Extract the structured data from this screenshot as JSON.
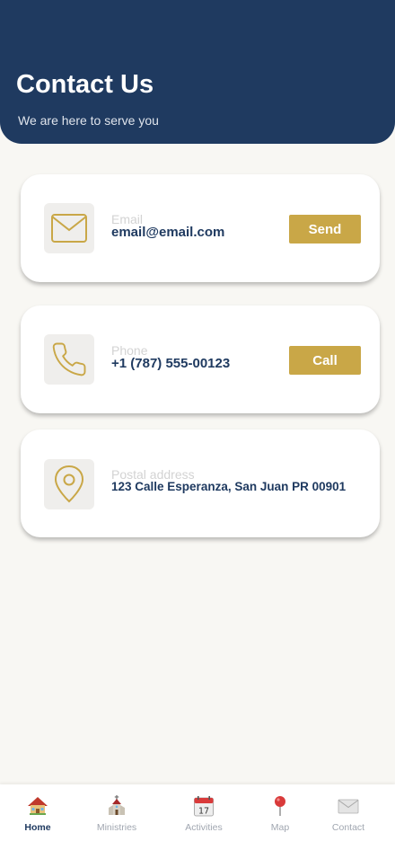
{
  "header": {
    "title": "Contact Us",
    "subtitle": "We are here to serve you"
  },
  "contacts": [
    {
      "icon": "mail-icon",
      "label": "Email",
      "value": "email@email.com",
      "action": "Send"
    },
    {
      "icon": "phone-icon",
      "label": "Phone",
      "value": "+1 (787) 555-00123",
      "action": "Call"
    },
    {
      "icon": "location-pin-icon",
      "label": "Postal address",
      "value": "123 Calle Esperanza, San Juan PR 00901"
    }
  ],
  "tabs": [
    {
      "icon": "house-icon",
      "label": "Home",
      "active": true
    },
    {
      "icon": "church-icon",
      "label": "Ministries",
      "active": false
    },
    {
      "icon": "calendar-icon",
      "label": "Activities",
      "active": false,
      "calendar_day": "17"
    },
    {
      "icon": "map-pin-icon",
      "label": "Map",
      "active": false
    },
    {
      "icon": "envelope-icon",
      "label": "Contact",
      "active": false
    }
  ],
  "colors": {
    "primary": "#1f3a60",
    "accent": "#c9a747",
    "background": "#f8f7f3"
  }
}
